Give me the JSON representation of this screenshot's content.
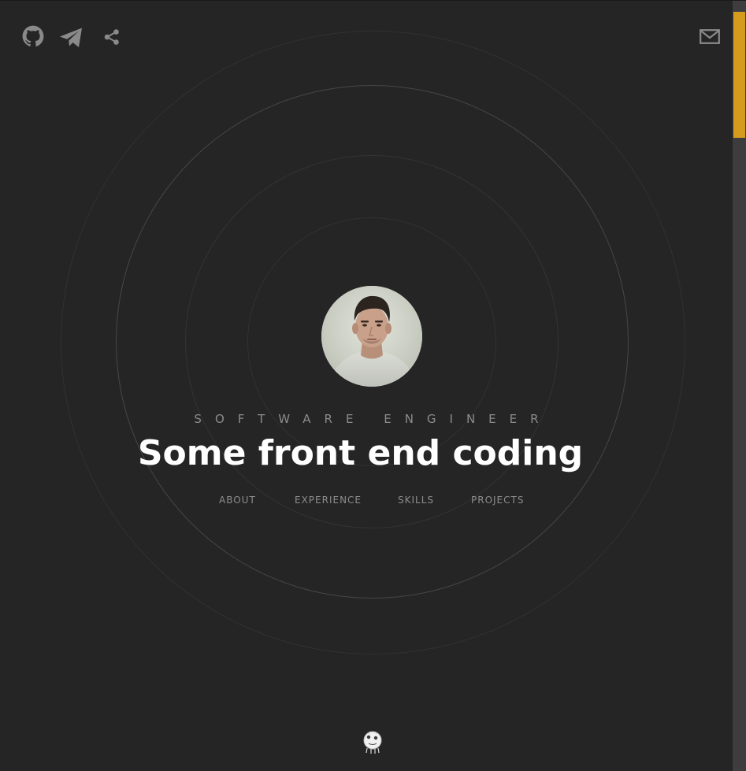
{
  "header": {
    "social_icons": [
      "github-icon",
      "telegram-icon",
      "share-icon"
    ],
    "contact_icon": "mail-icon"
  },
  "hero": {
    "subtitle": "SOFTWARE ENGINEER",
    "headline": "Some front end coding"
  },
  "nav": {
    "items": [
      {
        "label": "ABOUT"
      },
      {
        "label": "EXPERIENCE"
      },
      {
        "label": "SKILLS"
      },
      {
        "label": "PROJECTS"
      }
    ]
  },
  "footer": {
    "mascot_icon": "mascot-icon"
  },
  "colors": {
    "background": "#252525",
    "accent": "#d59b1d",
    "icon": "#8a8a8a",
    "text_muted": "#8b8b8b",
    "headline": "#ffffff"
  }
}
